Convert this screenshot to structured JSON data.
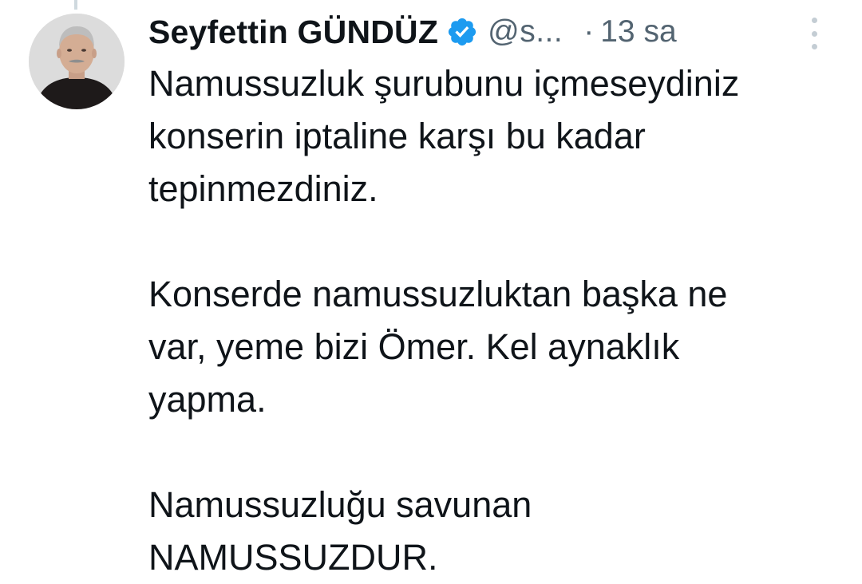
{
  "author": {
    "name": "Seyfettin GÜNDÜZ",
    "handle": "@s...",
    "time": "13 sa",
    "verified_icon": "verified-badge-icon",
    "avatar_icon": "profile-photo"
  },
  "tweet": {
    "paragraphs": [
      {
        "lines": [
          "Namussuzluk şurubunu içmeseydiniz",
          "konserin iptaline karşı bu kadar",
          "tepinmezdiniz."
        ]
      },
      {
        "lines": [
          "Konserde namussuzluktan başka ne",
          "var, yeme bizi Ömer. Kel aynaklık",
          "yapma."
        ]
      },
      {
        "lines": [
          "Namussuzluğu savunan",
          "NAMUSSUZDUR."
        ]
      }
    ]
  },
  "colors": {
    "text": "#0f1419",
    "muted": "#536471",
    "verified": "#1d9bf0"
  }
}
